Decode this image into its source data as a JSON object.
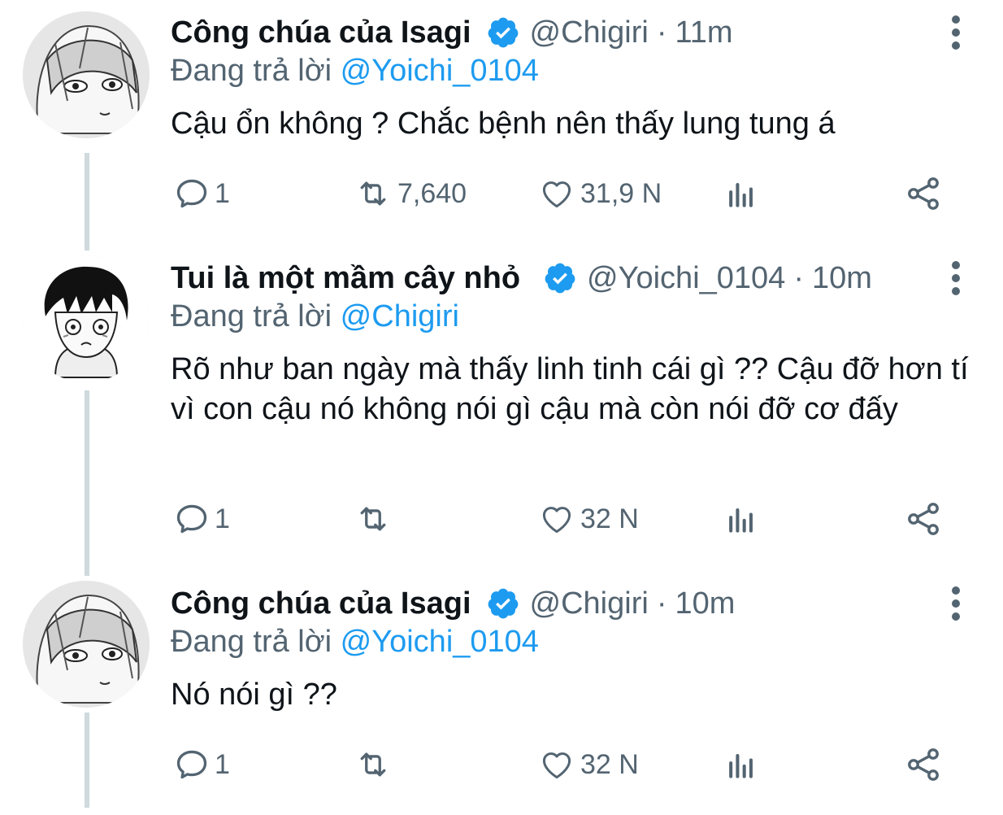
{
  "tweets": [
    {
      "display_name": "Công chúa của Isagi",
      "handle": "@Chigiri",
      "separator": "·",
      "time": "11m",
      "reply_prefix": "Đang trả lời",
      "reply_to": "@Yoichi_0104",
      "text": "Cậu ổn không ? Chắc bệnh nên thấy lung tung á",
      "replies": "1",
      "retweets": "7,640",
      "likes": "31,9 N",
      "avatar": "manga-white-haired-avatar"
    },
    {
      "display_name": "Tui là một mầm cây nhỏ",
      "handle": "@Yoichi_0104",
      "separator": "·",
      "time": "10m",
      "reply_prefix": "Đang trả lời",
      "reply_to": "@Chigiri",
      "text": "Rõ như ban ngày mà thấy linh tinh cái gì ?? Cậu đỡ hơn tí vì con cậu nó không nói gì cậu mà còn nói đỡ cơ đấy",
      "replies": "1",
      "retweets": "",
      "likes": "32 N",
      "avatar": "manga-black-haired-avatar"
    },
    {
      "display_name": "Công chúa của Isagi",
      "handle": "@Chigiri",
      "separator": "·",
      "time": "10m",
      "reply_prefix": "Đang trả lời",
      "reply_to": "@Yoichi_0104",
      "text": "Nó nói gì ??",
      "replies": "1",
      "retweets": "",
      "likes": "32 N",
      "avatar": "manga-white-haired-avatar"
    }
  ],
  "colors": {
    "text_primary": "#0f1419",
    "text_secondary": "#536471",
    "accent_blue": "#1d9bf0",
    "thread_line": "#cfd9de"
  }
}
